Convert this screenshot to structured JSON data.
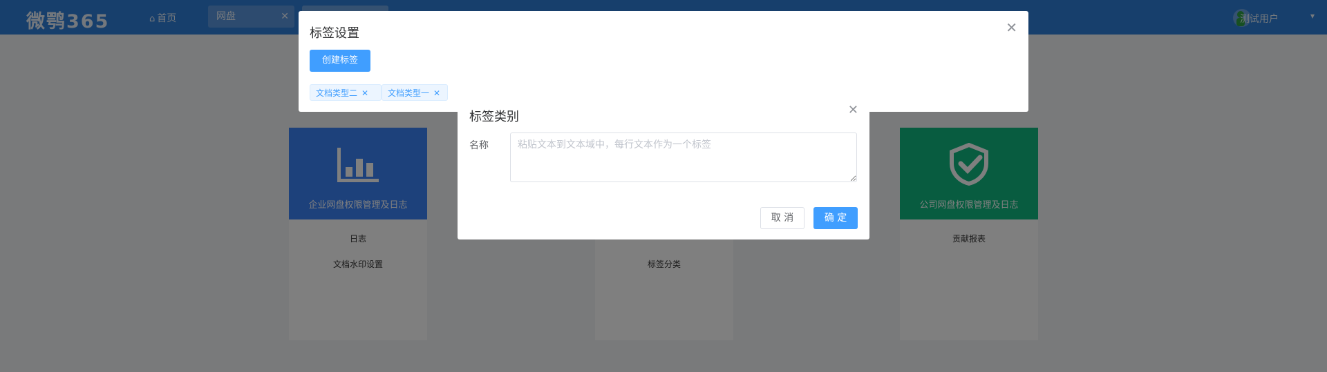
{
  "header": {
    "brand": "微鹗365",
    "home_label": "首页",
    "tabs": [
      {
        "label": "网盘"
      },
      {
        "label": ""
      }
    ],
    "user_name": "测试用户"
  },
  "cards": [
    {
      "title": "企业网盘权限管理及日志",
      "links": [
        "日志",
        "文档水印设置"
      ]
    },
    {
      "title": "",
      "links": [
        "",
        "标签分类"
      ]
    },
    {
      "title": "公司网盘权限管理及日志",
      "links": [
        "贡献报表"
      ]
    }
  ],
  "tag_settings_dialog": {
    "title": "标签设置",
    "create_button": "创建标签",
    "tags": [
      "文档类型二",
      "文档类型一"
    ]
  },
  "tag_category_dialog": {
    "title": "标签类别",
    "name_label": "名称",
    "textarea_placeholder": "粘贴文本到文本域中，每行文本作为一个标签",
    "cancel_button": "取 消",
    "confirm_button": "确 定"
  },
  "colors": {
    "primary": "#409eff",
    "header": "#2f7fd8"
  }
}
